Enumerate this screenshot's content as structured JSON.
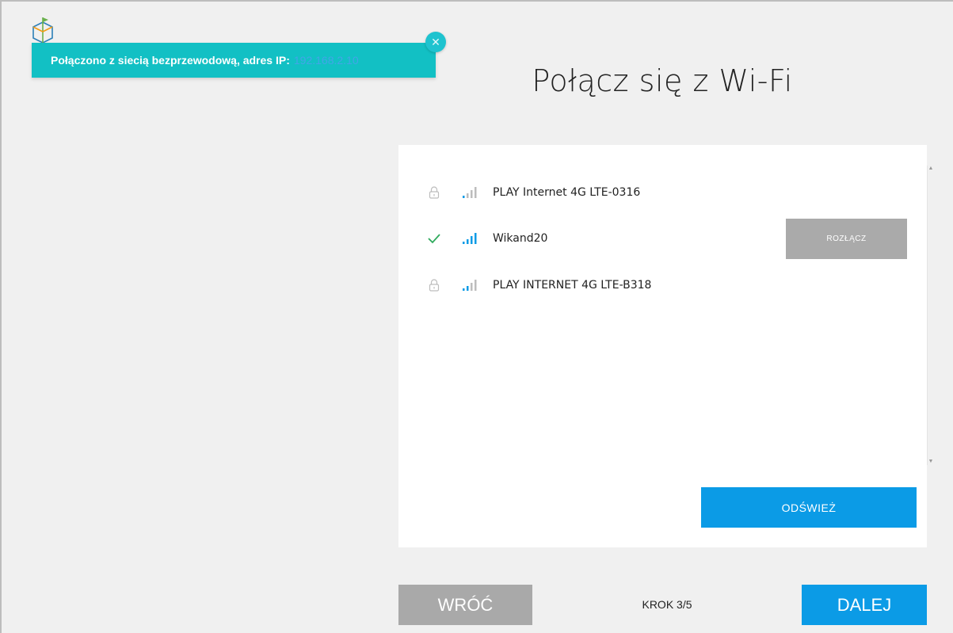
{
  "toast": {
    "message": "Połączono z siecią bezprzewodową, adres IP:",
    "ip": "192.168.2.10",
    "close_icon": "close-icon"
  },
  "page": {
    "title": "Połącz się z Wi-Fi"
  },
  "networks": [
    {
      "name": "PLAY Internet 4G LTE-0316",
      "status_icon": "lock-icon",
      "signal_icon": "signal-icon",
      "connected": false
    },
    {
      "name": "Wikand20",
      "status_icon": "check-icon",
      "signal_icon": "signal-icon",
      "connected": true
    },
    {
      "name": "PLAY INTERNET 4G LTE-B318",
      "status_icon": "lock-icon",
      "signal_icon": "signal-icon",
      "connected": false
    }
  ],
  "buttons": {
    "disconnect": "ROZŁĄCZ",
    "refresh": "ODŚWIEŻ",
    "back": "WRÓĆ",
    "next": "DALEJ"
  },
  "step": "KROK 3/5",
  "colors": {
    "toast_bg": "#12c0c4",
    "primary": "#0b9be6",
    "secondary": "#a9a9a9",
    "check": "#2eaa5c"
  }
}
